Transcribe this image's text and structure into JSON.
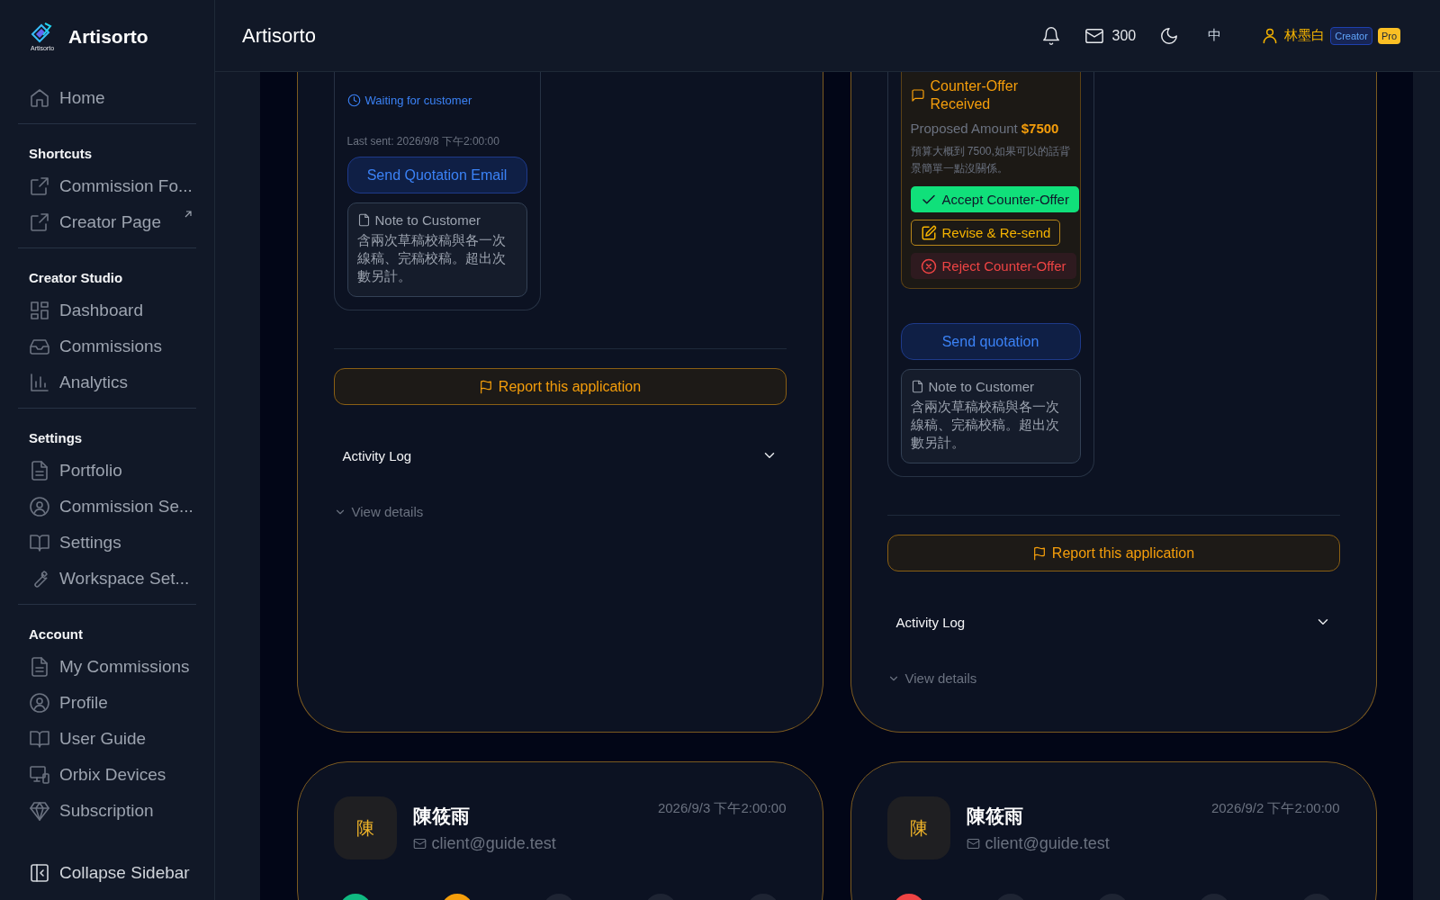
{
  "sidebar": {
    "brand": "Artisorto",
    "logo_caption": "Artisorto",
    "sections": [
      {
        "items": [
          {
            "label": "Home",
            "external_mark": false
          }
        ]
      },
      {
        "title": "Shortcuts",
        "items": [
          {
            "label": "Commission Fo...",
            "external_mark": false
          },
          {
            "label": "Creator Page",
            "external_mark": true
          }
        ]
      },
      {
        "title": "Creator Studio",
        "items": [
          {
            "label": "Dashboard",
            "external_mark": false
          },
          {
            "label": "Commissions",
            "external_mark": false
          },
          {
            "label": "Analytics",
            "external_mark": false
          }
        ]
      },
      {
        "title": "Settings",
        "items": [
          {
            "label": "Portfolio",
            "external_mark": false
          },
          {
            "label": "Commission Se...",
            "external_mark": false
          },
          {
            "label": "Settings",
            "external_mark": false
          },
          {
            "label": "Workspace Set...",
            "external_mark": false
          }
        ]
      },
      {
        "title": "Account",
        "items": [
          {
            "label": "My Commissions",
            "external_mark": false
          },
          {
            "label": "Profile",
            "external_mark": false
          },
          {
            "label": "User Guide",
            "external_mark": false
          },
          {
            "label": "Orbix Devices",
            "external_mark": false
          },
          {
            "label": "Subscription",
            "external_mark": false
          }
        ]
      }
    ],
    "collapse": "Collapse Sidebar"
  },
  "header": {
    "title": "Artisorto",
    "mail_count": "300",
    "language": "中",
    "user": "林墨白",
    "badges": [
      {
        "label": "Creator",
        "kind": "role"
      },
      {
        "label": "Pro",
        "kind": "plan"
      }
    ]
  },
  "cards": [
    {
      "kind": "detail",
      "panel": {
        "status": "Waiting for customer",
        "last_sent": "Last sent: 2026/9/8 下午2:00:00",
        "send_button": "Send Quotation Email",
        "note": {
          "title": "Note to Customer",
          "text": "含兩次草稿校稿與各一次線稿、完稿校稿。超出次數另計。"
        }
      },
      "report": "Report this application",
      "activity": {
        "title": "Activity Log",
        "expanded": false
      },
      "details": "View details"
    },
    {
      "kind": "detail",
      "panel": {
        "counter_offer": {
          "title": "Counter-Offer Received",
          "amount_label": "Proposed Amount",
          "amount": "$7500",
          "message": "預算大概到 7500,如果可以的話背景簡單一點沒關係。",
          "actions": [
            {
              "label": "Accept Counter-Offer",
              "kind": "accept"
            },
            {
              "label": "Revise & Re-send",
              "kind": "revise"
            },
            {
              "label": "Reject Counter-Offer",
              "kind": "reject"
            }
          ]
        },
        "send_button": "Send quotation",
        "note": {
          "title": "Note to Customer",
          "text": "含兩次草稿校稿與各一次線稿、完稿校稿。超出次數另計。"
        }
      },
      "report": "Report this application",
      "activity": {
        "title": "Activity Log",
        "expanded": false
      },
      "details": "View details"
    },
    {
      "kind": "summary",
      "avatar": "陳",
      "name": "陳筱雨",
      "email": "client@guide.test",
      "date": "2026/9/3 下午2:00:00",
      "steps": [
        {
          "color": "#10b981"
        },
        {
          "color": "#f59e0b"
        },
        {
          "color": "#1e2433"
        },
        {
          "color": "#1e2433"
        },
        {
          "color": "#1e2433"
        }
      ]
    },
    {
      "kind": "summary",
      "avatar": "陳",
      "name": "陳筱雨",
      "email": "client@guide.test",
      "date": "2026/9/2 下午2:00:00",
      "steps": [
        {
          "color": "#ef4444"
        },
        {
          "color": "#1e2433"
        },
        {
          "color": "#1e2433"
        },
        {
          "color": "#1e2433"
        },
        {
          "color": "#1e2433"
        }
      ]
    }
  ]
}
